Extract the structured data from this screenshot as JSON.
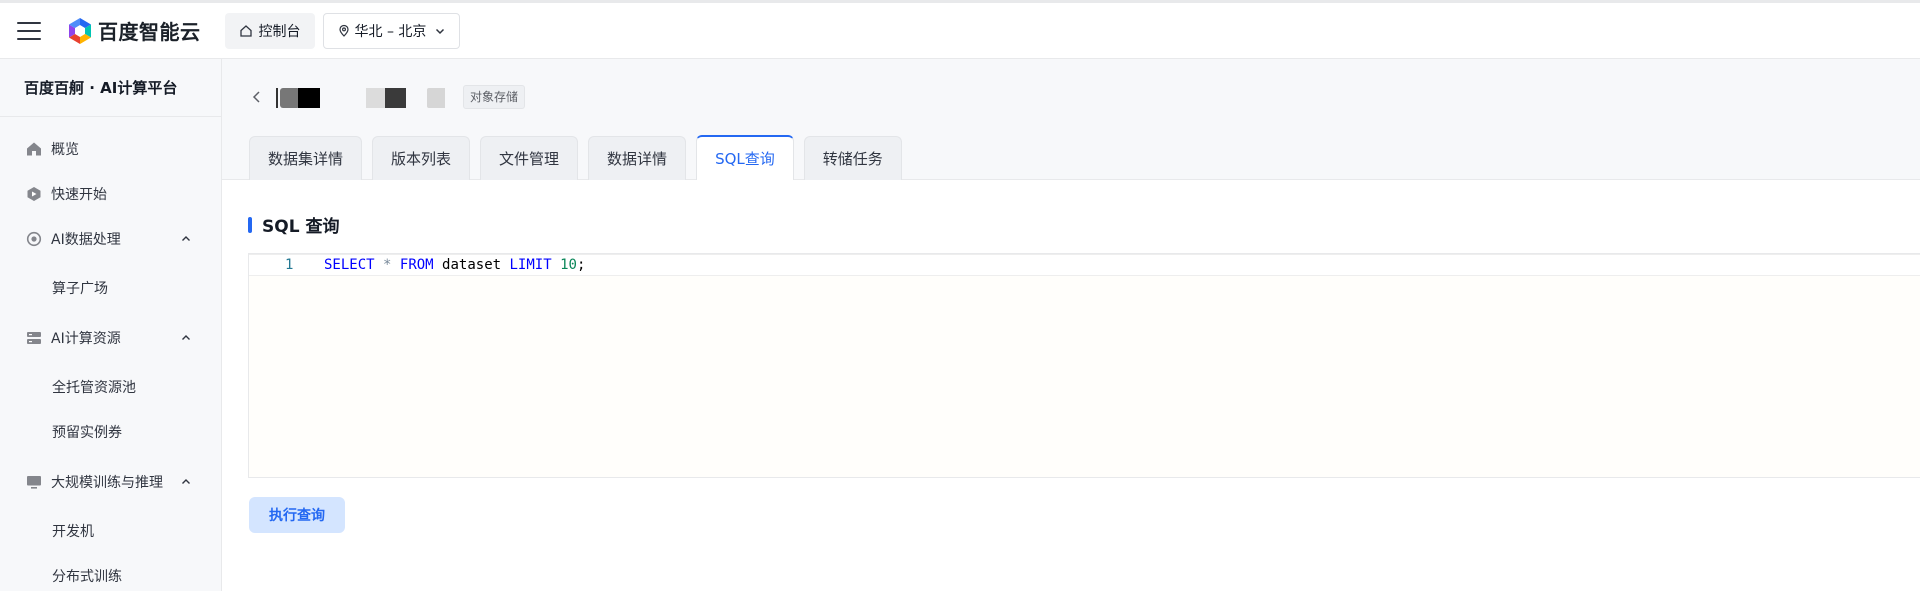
{
  "brand": {
    "name": "百度智能云"
  },
  "header": {
    "console_label": "控制台",
    "region_label": "华北 – 北京"
  },
  "sidebar": {
    "title": "百度百舸 · AI计算平台",
    "items": [
      {
        "label": "概览",
        "icon": "home-icon"
      },
      {
        "label": "快速开始",
        "icon": "rocket-icon"
      },
      {
        "label": "AI数据处理",
        "icon": "data-process-icon",
        "expanded": true
      },
      {
        "label": "算子广场"
      },
      {
        "label": "AI计算资源",
        "icon": "server-icon",
        "expanded": true
      },
      {
        "label": "全托管资源池"
      },
      {
        "label": "预留实例券"
      },
      {
        "label": "大规模训练与推理",
        "icon": "monitor-icon",
        "expanded": true
      },
      {
        "label": "开发机"
      },
      {
        "label": "分布式训练"
      }
    ]
  },
  "page": {
    "storage_tag": "对象存储",
    "tabs": [
      "数据集详情",
      "版本列表",
      "文件管理",
      "数据详情",
      "SQL查询",
      "转储任务"
    ],
    "active_tab": "SQL查询",
    "section_title": "SQL 查询",
    "editor": {
      "line_number": "1",
      "tokens": {
        "select": "SELECT",
        "star": "*",
        "from": "FROM",
        "table": "dataset",
        "limit": "LIMIT",
        "limit_value": "10",
        "semicolon": ";"
      }
    },
    "run_button": "执行查询"
  },
  "colors": {
    "accent": "#2468f2",
    "keyword": "#0000ff",
    "number": "#098658"
  }
}
